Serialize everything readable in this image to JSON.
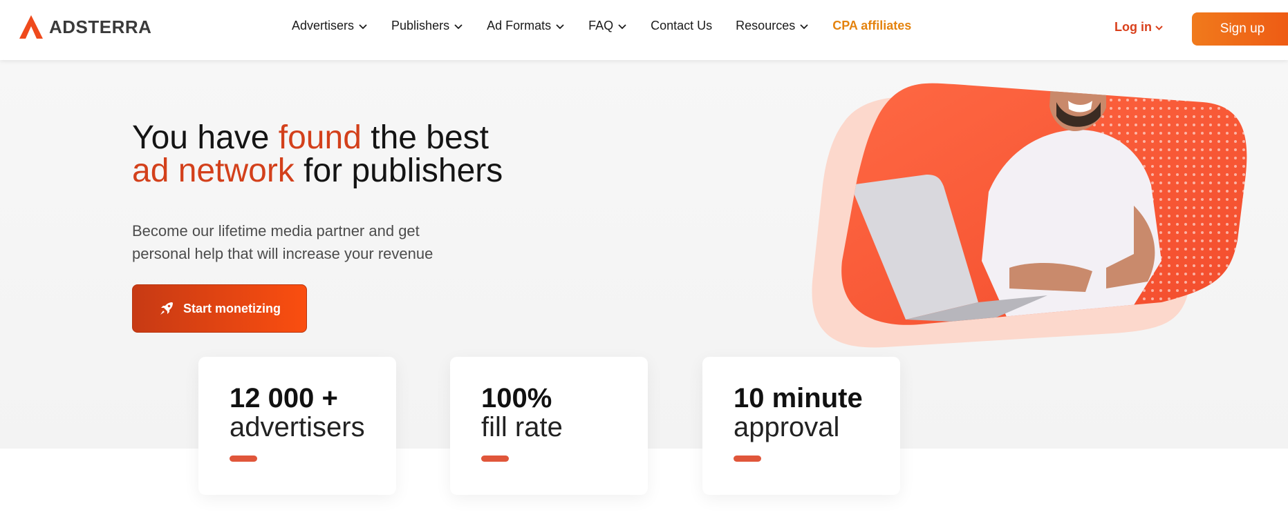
{
  "brand": {
    "name": "ADSTERRA",
    "accent": "#d3401b",
    "cpa_color": "#e4830f"
  },
  "nav": {
    "items": [
      {
        "label": "Advertisers",
        "dropdown": true
      },
      {
        "label": "Publishers",
        "dropdown": true
      },
      {
        "label": "Ad Formats",
        "dropdown": true
      },
      {
        "label": "FAQ",
        "dropdown": true
      },
      {
        "label": "Contact Us",
        "dropdown": false
      },
      {
        "label": "Resources",
        "dropdown": true
      },
      {
        "label": "CPA affiliates",
        "dropdown": false
      }
    ],
    "login_label": "Log in",
    "signup_label": "Sign up"
  },
  "hero": {
    "headline_part1": "You have ",
    "headline_highlight1": "found",
    "headline_part2": " the best",
    "headline_highlight2": "ad network",
    "headline_part3": " for publishers",
    "subtext_line1": "Become our lifetime media partner and get",
    "subtext_line2": "personal help that will increase your revenue",
    "cta_label": "Start monetizing",
    "cta_icon": "rocket-icon"
  },
  "stats": [
    {
      "big": "12 000 +",
      "small": "advertisers"
    },
    {
      "big": "100%",
      "small": "fill rate"
    },
    {
      "big": "10 minute",
      "small": "approval"
    }
  ]
}
